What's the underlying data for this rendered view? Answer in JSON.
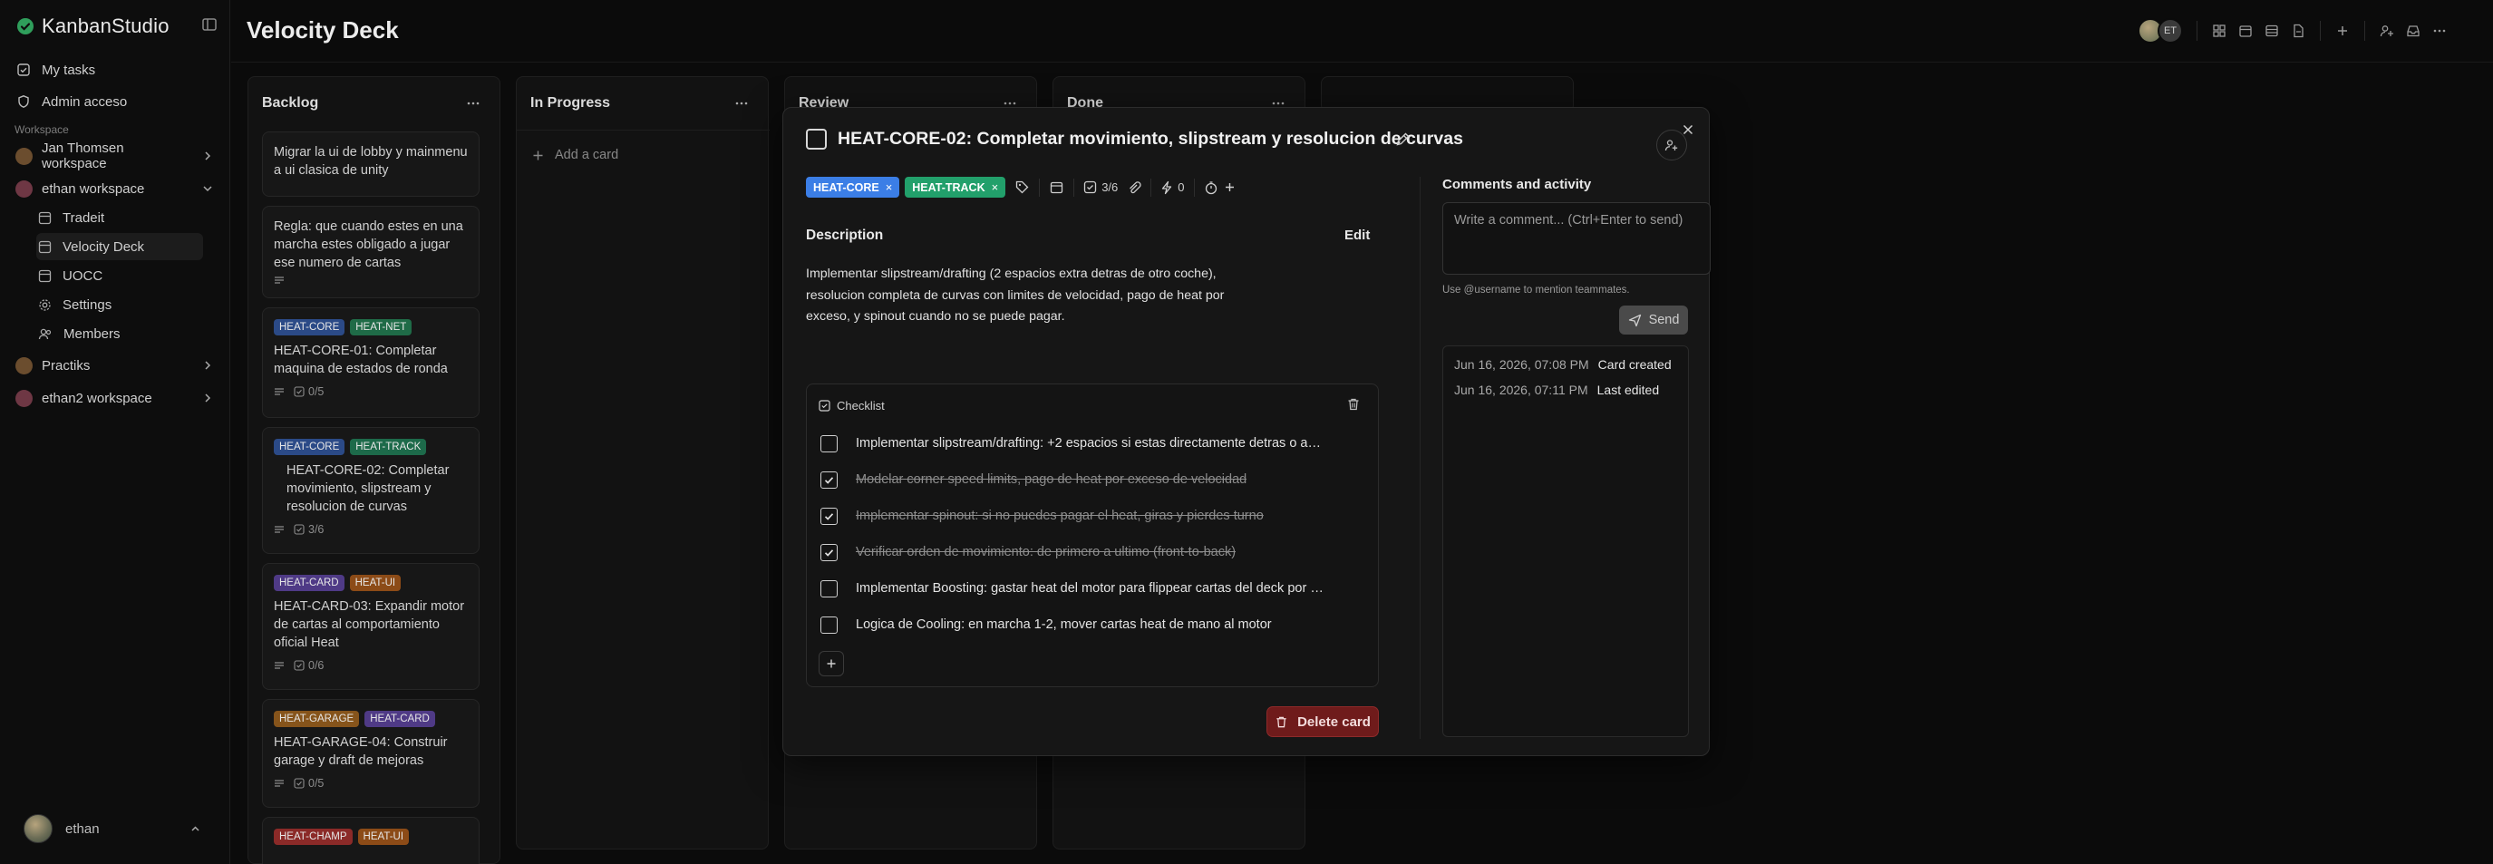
{
  "app": {
    "name": "KanbanStudio"
  },
  "sidebar": {
    "nav": [
      {
        "label": "My tasks",
        "icon": "checkbox-icon"
      },
      {
        "label": "Admin acceso",
        "icon": "shield-icon"
      }
    ],
    "workspace_section_label": "Workspace",
    "workspaces": [
      {
        "label": "Jan Thomsen workspace"
      },
      {
        "label": "ethan workspace"
      }
    ],
    "boards": [
      {
        "label": "Tradeit"
      },
      {
        "label": "Velocity Deck"
      },
      {
        "label": "UOCC"
      }
    ],
    "settings_label": "Settings",
    "members_label": "Members",
    "other_workspaces": [
      {
        "label": "Practiks"
      },
      {
        "label": "ethan2 workspace"
      }
    ],
    "user": {
      "name": "ethan"
    }
  },
  "header": {
    "title": "Velocity Deck",
    "avatars": [
      "",
      "ET"
    ]
  },
  "columns": {
    "backlog": {
      "title": "Backlog"
    },
    "in_progress": {
      "title": "In Progress",
      "add_card": "Add a card"
    },
    "review": {
      "title": "Review"
    },
    "done": {
      "title": "Done"
    }
  },
  "cards": [
    {
      "title": "Migrar la ui de lobby y mainmenu a ui clasica de unity"
    },
    {
      "title": "Regla: que cuando estes en una marcha estes obligado a jugar ese numero de cartas"
    },
    {
      "tags": [
        "HEAT-CORE",
        "HEAT-NET"
      ],
      "title": "HEAT-CORE-01: Completar maquina de estados de ronda",
      "checklist": "0/5"
    },
    {
      "tags": [
        "HEAT-CORE",
        "HEAT-TRACK"
      ],
      "title": "HEAT-CORE-02: Completar movimiento, slipstream y resolucion de curvas",
      "checklist": "3/6"
    },
    {
      "tags": [
        "HEAT-CARD",
        "HEAT-UI"
      ],
      "title": "HEAT-CARD-03: Expandir motor de cartas al comportamiento oficial Heat",
      "checklist": "0/6"
    },
    {
      "tags": [
        "HEAT-GARAGE",
        "HEAT-CARD"
      ],
      "title": "HEAT-GARAGE-04: Construir garage y draft de mejoras",
      "checklist": "0/5"
    },
    {
      "tags": [
        "HEAT-CHAMP",
        "HEAT-UI"
      ]
    }
  ],
  "modal": {
    "title": "HEAT-CORE-02: Completar movimiento, slipstream y resolucion de curvas",
    "tags": [
      "HEAT-CORE",
      "HEAT-TRACK"
    ],
    "checklist_count": "3/6",
    "power_count": "0",
    "description_label": "Description",
    "edit_label": "Edit",
    "description": "Implementar slipstream/drafting (2 espacios extra detras de otro coche), resolucion completa de curvas con limites de velocidad, pago de heat por exceso, y spinout cuando no se puede pagar.",
    "checklist": {
      "label": "Checklist",
      "items": [
        {
          "text": "Implementar slipstream/drafting: +2 espacios si estas directamente detras o adya...",
          "done": false
        },
        {
          "text": "Modelar corner speed limits, pago de heat por exceso de velocidad",
          "done": true
        },
        {
          "text": "Implementar spinout: si no puedes pagar el heat, giras y pierdes turno",
          "done": true
        },
        {
          "text": "Verificar orden de movimiento: de primero a ultimo (front-to-back)",
          "done": true
        },
        {
          "text": "Implementar Boosting: gastar heat del motor para flippear cartas del deck por mo...",
          "done": false
        },
        {
          "text": "Logica de Cooling: en marcha 1-2, mover cartas heat de mano al motor",
          "done": false
        }
      ]
    },
    "delete_label": "Delete card",
    "comments": {
      "label": "Comments and activity",
      "placeholder": "Write a comment... (Ctrl+Enter to send)",
      "hint": "Use @username to mention teammates.",
      "send_label": "Send"
    },
    "activity": [
      {
        "time": "Jun 16, 2026, 07:08 PM",
        "text": "Card created"
      },
      {
        "time": "Jun 16, 2026, 07:11 PM",
        "text": "Last edited"
      }
    ]
  },
  "colors": {
    "background": "#0b0b0b",
    "modal_bg": "#161616",
    "tag_core": "#3b7ee6",
    "tag_track": "#22a06b",
    "delete": "#6f1b1b"
  }
}
